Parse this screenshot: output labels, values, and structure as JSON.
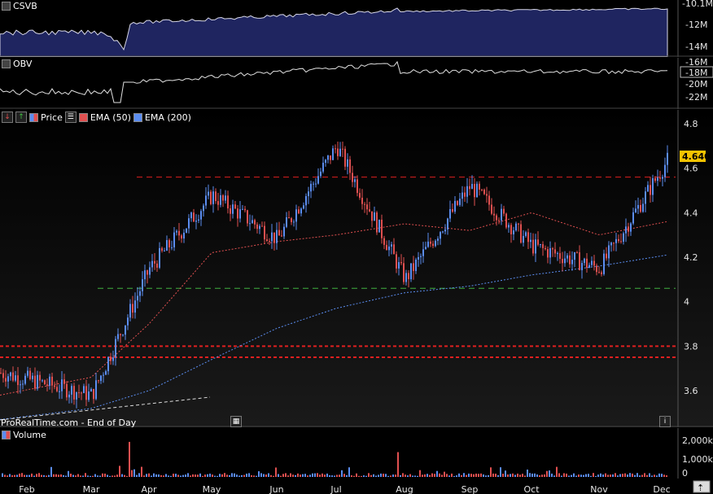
{
  "panels": {
    "csvb": {
      "label": "CSVB",
      "ticks": [
        "-10.1M",
        "-12M",
        "-14M"
      ]
    },
    "obv": {
      "label": "OBV",
      "ticks": [
        "-16M",
        "-18M",
        "-20M",
        "-22M"
      ]
    },
    "price": {
      "legend": [
        {
          "name": "Price",
          "color": "#ffffff"
        },
        {
          "name": "EMA (50)",
          "color": "#e05050"
        },
        {
          "name": "EMA (200)",
          "color": "#5b8df0"
        }
      ],
      "ticks": [
        "4.8",
        "4.6",
        "4.4",
        "4.2",
        "4",
        "3.8",
        "3.6"
      ],
      "last_value": "4.640",
      "footer": "ProRealTime.com - End of Day"
    },
    "volume": {
      "label": "Volume",
      "ticks": [
        "2,000k",
        "1,000k",
        "0"
      ]
    }
  },
  "months": [
    "Feb",
    "Mar",
    "Apr",
    "May",
    "Jun",
    "Jul",
    "Aug",
    "Sep",
    "Oct",
    "Nov",
    "Dec"
  ],
  "colors": {
    "up": "#5b8df0",
    "down": "#e05050",
    "bg": "#000000",
    "resistance": "#e02020",
    "support": "#40b040",
    "highlight": "#f5c400"
  },
  "chart_data": {
    "type": "line",
    "title": "",
    "xlabel": "",
    "ylabel": "",
    "ylim": [
      3.45,
      4.85
    ],
    "x": [
      "Feb",
      "Mar",
      "Apr",
      "May",
      "Jun",
      "Jul",
      "Aug",
      "Sep",
      "Oct",
      "Nov",
      "Dec"
    ],
    "series": [
      {
        "name": "Price",
        "values": [
          3.68,
          3.58,
          4.15,
          4.48,
          4.28,
          4.7,
          4.1,
          4.52,
          4.25,
          4.15,
          4.64
        ]
      },
      {
        "name": "EMA (50)",
        "values": [
          3.58,
          3.66,
          3.9,
          4.22,
          4.27,
          4.3,
          4.35,
          4.32,
          4.4,
          4.3,
          4.36
        ]
      },
      {
        "name": "EMA (200)",
        "values": [
          3.47,
          3.52,
          3.6,
          3.74,
          3.88,
          3.97,
          4.04,
          4.07,
          4.12,
          4.16,
          4.21
        ]
      }
    ],
    "levels": [
      {
        "value": 4.56,
        "color": "#e02020",
        "style": "dashed"
      },
      {
        "value": 4.06,
        "color": "#40b040",
        "style": "dashed"
      },
      {
        "value": 3.8,
        "color": "#e02020",
        "style": "dashed"
      },
      {
        "value": 3.75,
        "color": "#e02020",
        "style": "dashed"
      }
    ],
    "volume_k": [
      150,
      120,
      2050,
      200,
      250,
      300,
      1450,
      150,
      300,
      350,
      250
    ],
    "grid": false,
    "legend": "top-left"
  }
}
